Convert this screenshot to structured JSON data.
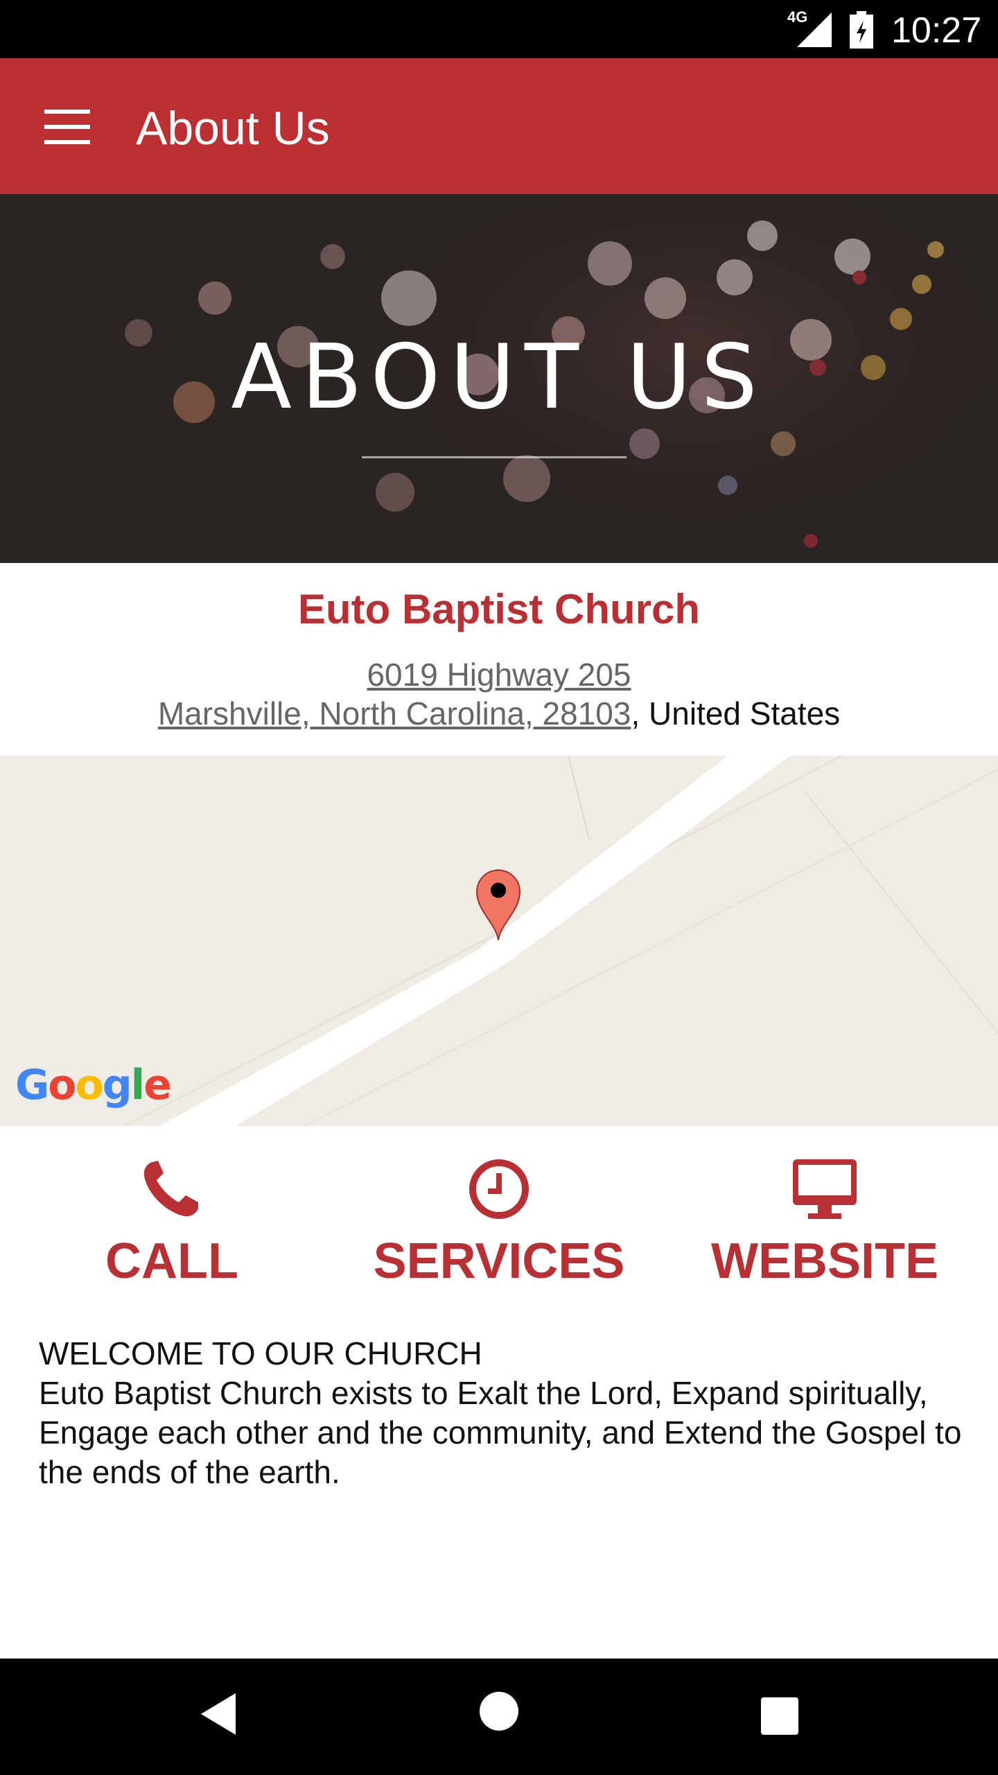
{
  "status_bar": {
    "network": "4G",
    "time": "10:27"
  },
  "app_bar": {
    "title": "About Us",
    "menu_icon": "hamburger-menu-icon"
  },
  "hero": {
    "title": "ABOUT US"
  },
  "church": {
    "name": "Euto Baptist Church",
    "address_line1": "6019 Highway 205",
    "address_line2_link": "Marshville, North Carolina, 28103",
    "address_line2_suffix": ", United States"
  },
  "map": {
    "logo_text": "Google",
    "marker_icon": "map-pin-icon"
  },
  "actions": [
    {
      "label": "CALL",
      "icon": "phone-icon"
    },
    {
      "label": "SERVICES",
      "icon": "clock-icon"
    },
    {
      "label": "WEBSITE",
      "icon": "monitor-icon"
    }
  ],
  "welcome": {
    "heading": "WELCOME TO OUR CHURCH",
    "body": "Euto Baptist Church exists to Exalt the Lord, Expand spiritually, Engage each other and the community, and Extend the Gospel to the ends of the earth."
  },
  "colors": {
    "brand": "#bc3034",
    "accent_text": "#b83034",
    "map_bg": "#efece6"
  }
}
